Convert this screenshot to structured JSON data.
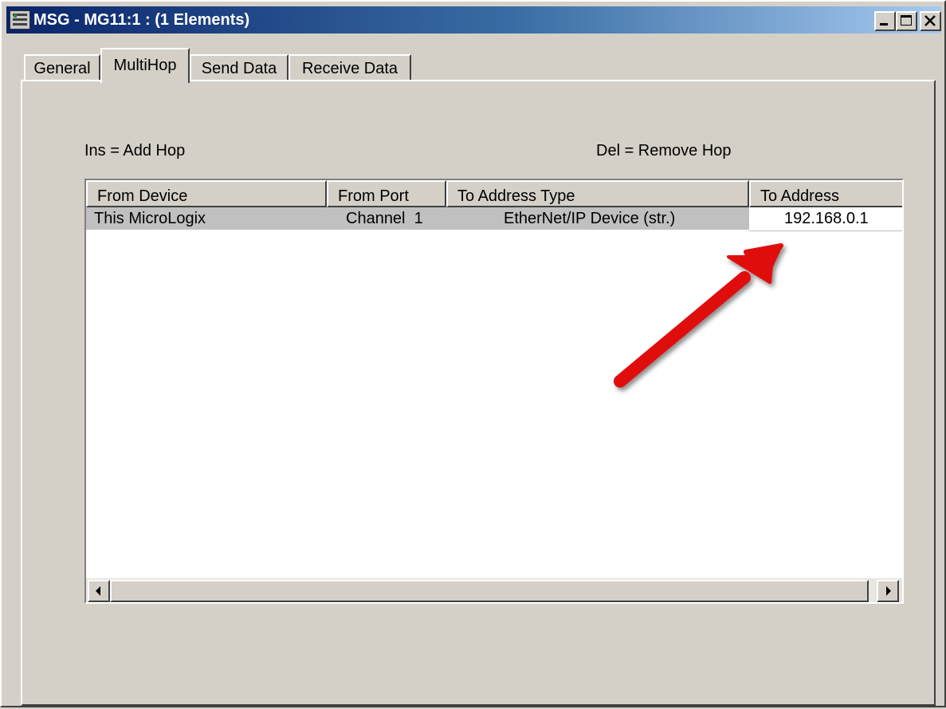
{
  "window": {
    "title": "MSG - MG11:1 : (1 Elements)",
    "controls": [
      "minimize",
      "maximize",
      "close"
    ]
  },
  "tabs": [
    {
      "label": "General",
      "active": false
    },
    {
      "label": "MultiHop",
      "active": true
    },
    {
      "label": "Send Data",
      "active": false
    },
    {
      "label": "Receive Data",
      "active": false
    }
  ],
  "hints": {
    "add": "Ins = Add Hop",
    "remove": "Del = Remove Hop"
  },
  "table": {
    "columns": [
      "From Device",
      "From Port",
      "To Address Type",
      "To Address"
    ],
    "rows": [
      {
        "from_device": "This MicroLogix",
        "from_port": "Channel  1",
        "to_address_type": "EtherNet/IP Device (str.)",
        "to_address": "192.168.0.1"
      }
    ]
  },
  "colors": {
    "title_start": "#0a246a",
    "title_end": "#a6caf0",
    "dialog_bg": "#d4d0c8",
    "selected_row": "#c0c0c0",
    "annotation_arrow": "#e01010"
  },
  "icons": {
    "app": "plc-rack-icon",
    "minimize": "minimize-icon",
    "maximize": "maximize-icon",
    "close": "close-icon",
    "scroll_left": "scroll-left-arrow-icon",
    "scroll_right": "scroll-right-arrow-icon",
    "annotation": "red-arrow-annotation"
  }
}
